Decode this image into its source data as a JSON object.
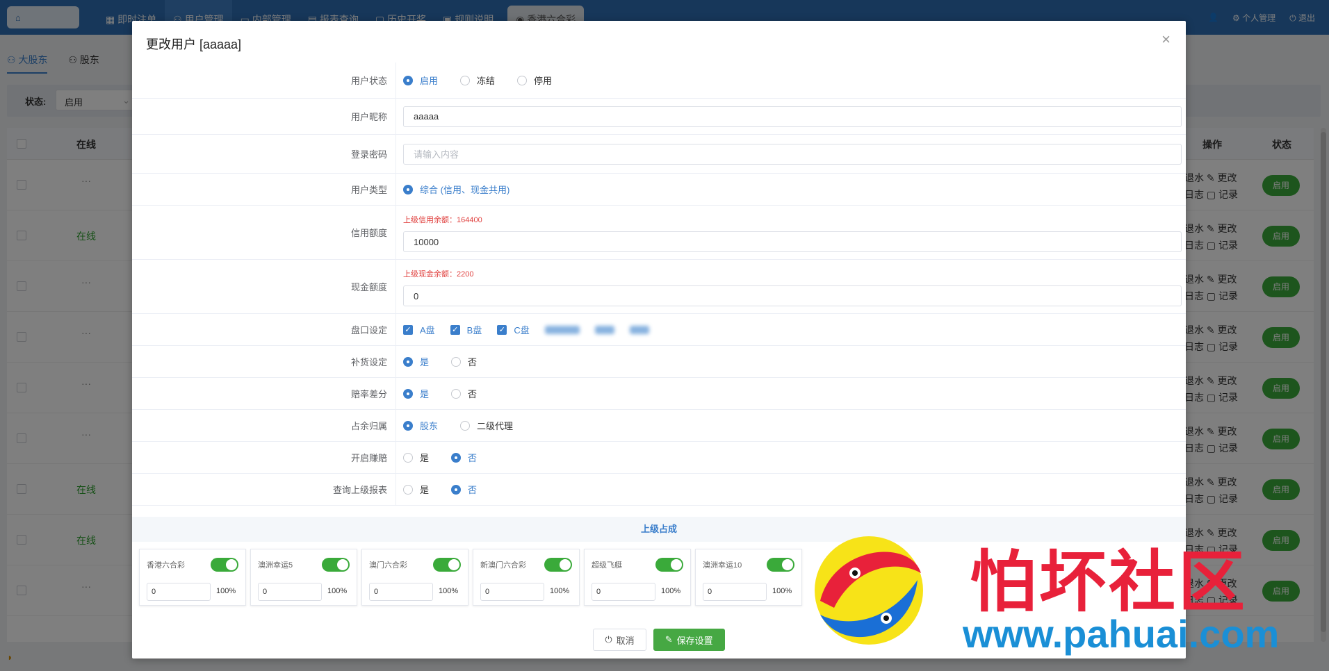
{
  "topbar": {
    "nav": [
      "即时注单",
      "用户管理",
      "内部管理",
      "报表查询",
      "历史开奖",
      "规则说明"
    ],
    "lottery_tab": "香港六合彩",
    "right": [
      "个人管理",
      "退出"
    ]
  },
  "background": {
    "subtabs": [
      "大股东",
      "股东"
    ],
    "filter_label": "状态:",
    "filter_value": "启用",
    "columns": {
      "online": "在线",
      "ops": "操作",
      "status": "状态"
    },
    "rows": [
      {
        "online": "···",
        "status": "启用"
      },
      {
        "online": "在线",
        "status": "启用"
      },
      {
        "online": "···",
        "status": "启用"
      },
      {
        "online": "···",
        "status": "启用"
      },
      {
        "online": "···",
        "status": "启用"
      },
      {
        "online": "···",
        "status": "启用"
      },
      {
        "online": "在线",
        "status": "启用"
      },
      {
        "online": "在线",
        "status": "启用"
      },
      {
        "online": "···",
        "status": "启用"
      }
    ],
    "ops_line1": "退水 ✎ 更改",
    "ops_line2": "日志 ▢ 记录"
  },
  "modal": {
    "title": "更改用户 [aaaaa]",
    "close": "×",
    "fields": {
      "status": {
        "label": "用户状态",
        "options": [
          "启用",
          "冻结",
          "停用"
        ],
        "selected": 0
      },
      "nickname": {
        "label": "用户昵称",
        "value": "aaaaa"
      },
      "password": {
        "label": "登录密码",
        "placeholder": "请输入内容"
      },
      "type": {
        "label": "用户类型",
        "options": [
          "综合 (信用、现金共用)"
        ],
        "selected": 0
      },
      "credit": {
        "label": "信用额度",
        "hint": "上级信用余额：164400",
        "value": "10000"
      },
      "cash": {
        "label": "现金额度",
        "hint": "上级现金余额：2200",
        "value": "0"
      },
      "pankou": {
        "label": "盘口设定",
        "options": [
          "A盘",
          "B盘",
          "C盘"
        ]
      },
      "replenish": {
        "label": "补货设定",
        "options": [
          "是",
          "否"
        ],
        "selected": 0
      },
      "odds_diff": {
        "label": "赔率差分",
        "options": [
          "是",
          "否"
        ],
        "selected": 0
      },
      "remainder": {
        "label": "占余归属",
        "options": [
          "股东",
          "二级代理"
        ],
        "selected": 0
      },
      "compensate": {
        "label": "开启赚赔",
        "options": [
          "是",
          "否"
        ],
        "selected": 1
      },
      "query_report": {
        "label": "查询上级报表",
        "options": [
          "是",
          "否"
        ],
        "selected": 1
      }
    },
    "section_title": "上级占成",
    "cards": [
      {
        "name": "香港六合彩",
        "value": "0",
        "pct": "100%"
      },
      {
        "name": "澳洲幸运5",
        "value": "0",
        "pct": "100%"
      },
      {
        "name": "澳门六合彩",
        "value": "0",
        "pct": "100%"
      },
      {
        "name": "新澳门六合彩",
        "value": "0",
        "pct": "100%"
      },
      {
        "name": "超级飞艇",
        "value": "0",
        "pct": "100%"
      },
      {
        "name": "澳洲幸运10",
        "value": "0",
        "pct": "100%"
      }
    ],
    "cancel": "取消",
    "save": "保存设置"
  },
  "watermark": {
    "text": "怕坏社区",
    "url": "www.pahuai.com"
  },
  "colors": {
    "primary": "#3a7ecb",
    "success": "#46a843",
    "danger": "#e0413f",
    "topbar": "#2f6fb4"
  }
}
